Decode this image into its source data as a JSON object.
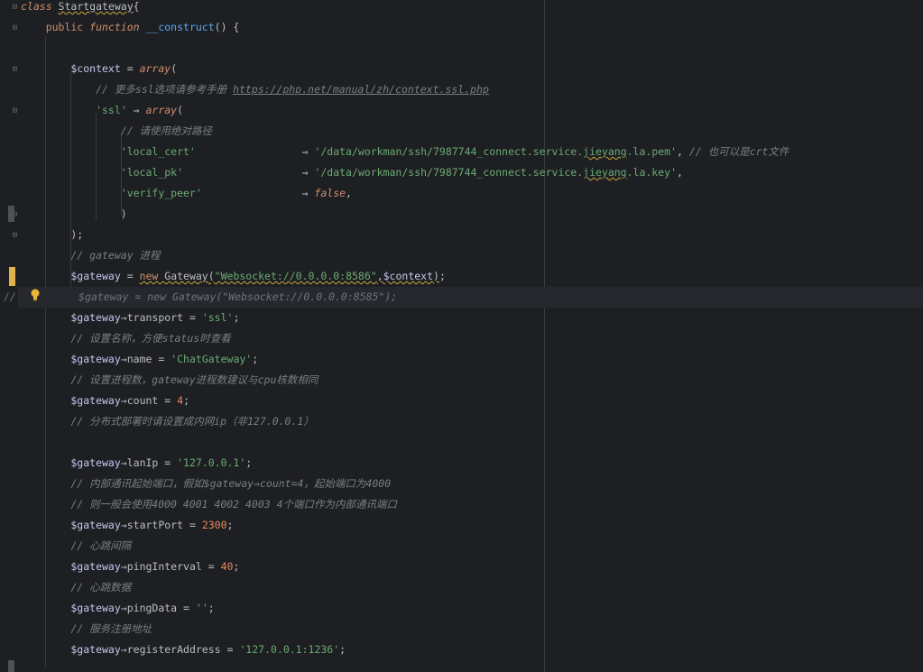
{
  "editor": {
    "lines": [
      {
        "parts": [
          {
            "t": "class ",
            "c": "kw"
          },
          {
            "t": "Startgateway",
            "c": "cls squig"
          },
          {
            "t": "{",
            "c": "plain"
          }
        ]
      },
      {
        "parts": [
          {
            "t": "    public ",
            "c": "kw2"
          },
          {
            "t": "function ",
            "c": "kw"
          },
          {
            "t": "__construct",
            "c": "meth"
          },
          {
            "t": "() {",
            "c": "plain"
          }
        ]
      },
      {
        "parts": []
      },
      {
        "parts": [
          {
            "t": "        $context",
            "c": "var"
          },
          {
            "t": " = ",
            "c": "plain"
          },
          {
            "t": "array",
            "c": "fn"
          },
          {
            "t": "(",
            "c": "plain"
          }
        ]
      },
      {
        "parts": [
          {
            "t": "            // 更多ssl选项请参考手册 ",
            "c": "cm"
          },
          {
            "t": "https://php.net/manual/zh/context.ssl.php",
            "c": "link"
          }
        ]
      },
      {
        "parts": [
          {
            "t": "            'ssl'",
            "c": "str"
          },
          {
            "t": " ⇒ ",
            "c": "plain"
          },
          {
            "t": "array",
            "c": "fn"
          },
          {
            "t": "(",
            "c": "plain"
          }
        ]
      },
      {
        "parts": [
          {
            "t": "                // 请使用绝对路径",
            "c": "cm"
          }
        ]
      },
      {
        "parts": [
          {
            "t": "                'local_cert'",
            "c": "str"
          },
          {
            "t": "                 ⇒ ",
            "c": "plain"
          },
          {
            "t": "'/data/workman/ssh/7987744_connect.service.",
            "c": "str"
          },
          {
            "t": "jieyang",
            "c": "str squig"
          },
          {
            "t": ".la.pem'",
            "c": "str"
          },
          {
            "t": ", ",
            "c": "plain"
          },
          {
            "t": "// 也可以是crt文件",
            "c": "cm"
          }
        ]
      },
      {
        "parts": [
          {
            "t": "                'local_pk'",
            "c": "str"
          },
          {
            "t": "                   ⇒ ",
            "c": "plain"
          },
          {
            "t": "'/data/workman/ssh/7987744_connect.service.",
            "c": "str"
          },
          {
            "t": "jieyang",
            "c": "str squig"
          },
          {
            "t": ".la.key'",
            "c": "str"
          },
          {
            "t": ",",
            "c": "plain"
          }
        ]
      },
      {
        "parts": [
          {
            "t": "                'verify_peer'",
            "c": "str"
          },
          {
            "t": "                ⇒ ",
            "c": "plain"
          },
          {
            "t": "false",
            "c": "kw"
          },
          {
            "t": ",",
            "c": "plain"
          }
        ]
      },
      {
        "parts": [
          {
            "t": "                )",
            "c": "plain"
          }
        ]
      },
      {
        "parts": [
          {
            "t": "        );",
            "c": "plain"
          }
        ]
      },
      {
        "parts": [
          {
            "t": "        // gateway 进程",
            "c": "cm"
          }
        ]
      },
      {
        "parts": [
          {
            "t": "        $gateway",
            "c": "var"
          },
          {
            "t": " = ",
            "c": "plain"
          },
          {
            "t": "new ",
            "c": "kw2 squig"
          },
          {
            "t": "Gateway",
            "c": "cls squig"
          },
          {
            "t": "(",
            "c": "plain squig"
          },
          {
            "t": "\"Websocket://0.0.0.0:8586\"",
            "c": "str squig"
          },
          {
            "t": ",",
            "c": "plain squig"
          },
          {
            "t": "$context",
            "c": "var squig"
          },
          {
            "t": ")",
            "c": "plain squig"
          },
          {
            "t": ";",
            "c": "plain"
          }
        ]
      },
      {
        "parts": [
          {
            "t": "//",
            "c": "ghost"
          },
          {
            "t": "          $gateway = new Gateway(\"Websocket://0.0.0.0:8585\");",
            "c": "ghost"
          }
        ]
      },
      {
        "parts": [
          {
            "t": "        $gateway",
            "c": "var"
          },
          {
            "t": "→",
            "c": "plain"
          },
          {
            "t": "transport",
            "c": "plain"
          },
          {
            "t": " = ",
            "c": "plain"
          },
          {
            "t": "'ssl'",
            "c": "str"
          },
          {
            "t": ";",
            "c": "plain"
          }
        ]
      },
      {
        "parts": [
          {
            "t": "        // 设置名称，方便status时查看",
            "c": "cm"
          }
        ]
      },
      {
        "parts": [
          {
            "t": "        $gateway",
            "c": "var"
          },
          {
            "t": "→",
            "c": "plain"
          },
          {
            "t": "name",
            "c": "plain"
          },
          {
            "t": " = ",
            "c": "plain"
          },
          {
            "t": "'ChatGateway'",
            "c": "str"
          },
          {
            "t": ";",
            "c": "plain"
          }
        ]
      },
      {
        "parts": [
          {
            "t": "        // 设置进程数，gateway进程数建议与cpu核数相同",
            "c": "cm"
          }
        ]
      },
      {
        "parts": [
          {
            "t": "        $gateway",
            "c": "var"
          },
          {
            "t": "→",
            "c": "plain"
          },
          {
            "t": "count",
            "c": "plain"
          },
          {
            "t": " = ",
            "c": "plain"
          },
          {
            "t": "4",
            "c": "orange"
          },
          {
            "t": ";",
            "c": "plain"
          }
        ]
      },
      {
        "parts": [
          {
            "t": "        // 分布式部署时请设置成内网ip（非127.0.0.1）",
            "c": "cm"
          }
        ]
      },
      {
        "parts": []
      },
      {
        "parts": [
          {
            "t": "        $gateway",
            "c": "var"
          },
          {
            "t": "→",
            "c": "plain"
          },
          {
            "t": "lanIp",
            "c": "plain"
          },
          {
            "t": " = ",
            "c": "plain"
          },
          {
            "t": "'127.0.0.1'",
            "c": "str"
          },
          {
            "t": ";",
            "c": "plain"
          }
        ]
      },
      {
        "parts": [
          {
            "t": "        // 内部通讯起始端口，假如$gateway→count=4，起始端口为4000",
            "c": "cm"
          }
        ]
      },
      {
        "parts": [
          {
            "t": "        // 则一般会使用4000 4001 4002 4003 4个端口作为内部通讯端口",
            "c": "cm"
          }
        ]
      },
      {
        "parts": [
          {
            "t": "        $gateway",
            "c": "var"
          },
          {
            "t": "→",
            "c": "plain"
          },
          {
            "t": "startPort",
            "c": "plain"
          },
          {
            "t": " = ",
            "c": "plain"
          },
          {
            "t": "2300",
            "c": "orange"
          },
          {
            "t": ";",
            "c": "plain"
          }
        ]
      },
      {
        "parts": [
          {
            "t": "        // 心跳间隔",
            "c": "cm"
          }
        ]
      },
      {
        "parts": [
          {
            "t": "        $gateway",
            "c": "var"
          },
          {
            "t": "→",
            "c": "plain"
          },
          {
            "t": "pingInterval",
            "c": "plain"
          },
          {
            "t": " = ",
            "c": "plain"
          },
          {
            "t": "40",
            "c": "orange"
          },
          {
            "t": ";",
            "c": "plain"
          }
        ]
      },
      {
        "parts": [
          {
            "t": "        // 心跳数据",
            "c": "cm"
          }
        ]
      },
      {
        "parts": [
          {
            "t": "        $gateway",
            "c": "var"
          },
          {
            "t": "→",
            "c": "plain"
          },
          {
            "t": "pingData",
            "c": "plain"
          },
          {
            "t": " = ",
            "c": "plain"
          },
          {
            "t": "''",
            "c": "str"
          },
          {
            "t": ";",
            "c": "plain"
          }
        ]
      },
      {
        "parts": [
          {
            "t": "        // 服务注册地址",
            "c": "cm"
          }
        ]
      },
      {
        "parts": [
          {
            "t": "        $gateway",
            "c": "var"
          },
          {
            "t": "→",
            "c": "plain"
          },
          {
            "t": "registerAddress",
            "c": "plain"
          },
          {
            "t": " = ",
            "c": "plain"
          },
          {
            "t": "'127.0.0.1:1236'",
            "c": "str"
          },
          {
            "t": ";",
            "c": "plain"
          }
        ]
      }
    ],
    "caret_line_index": 14,
    "modified_line_index": 13,
    "fold_markers": [
      {
        "line": 0,
        "glyph": "⊟"
      },
      {
        "line": 1,
        "glyph": "⊟"
      },
      {
        "line": 3,
        "glyph": "⊟"
      },
      {
        "line": 5,
        "glyph": "⊟"
      },
      {
        "line": 10,
        "glyph": "⊟"
      },
      {
        "line": 11,
        "glyph": "⊟"
      }
    ],
    "intention_icon": "lightbulb-icon"
  }
}
